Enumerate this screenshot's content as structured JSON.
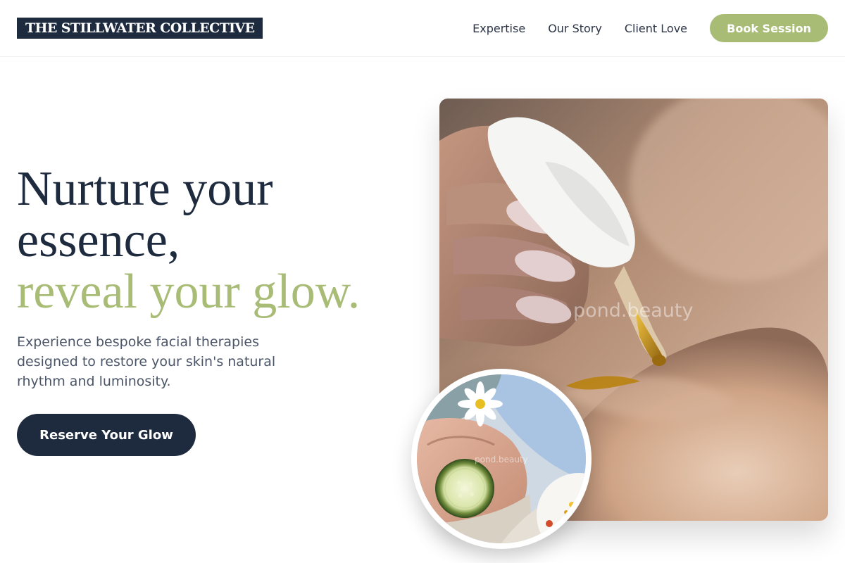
{
  "header": {
    "logo": "THE STILLWATER COLLECTIVE",
    "nav": [
      {
        "label": "Expertise"
      },
      {
        "label": "Our Story"
      },
      {
        "label": "Client Love"
      }
    ],
    "book_button": "Book Session"
  },
  "hero": {
    "headline_line1": "Nurture your",
    "headline_line2": "essence,",
    "headline_accent": "reveal your glow.",
    "subtext": "Experience bespoke facial therapies designed to restore your skin's natural rhythm and luminosity.",
    "cta": "Reserve Your Glow"
  },
  "images": {
    "main_watermark": "pond.beauty",
    "circle_watermark": "pond.beauty"
  },
  "colors": {
    "navy": "#1e2a3e",
    "sage": "#a8bc76",
    "text_muted": "#4b5568"
  }
}
